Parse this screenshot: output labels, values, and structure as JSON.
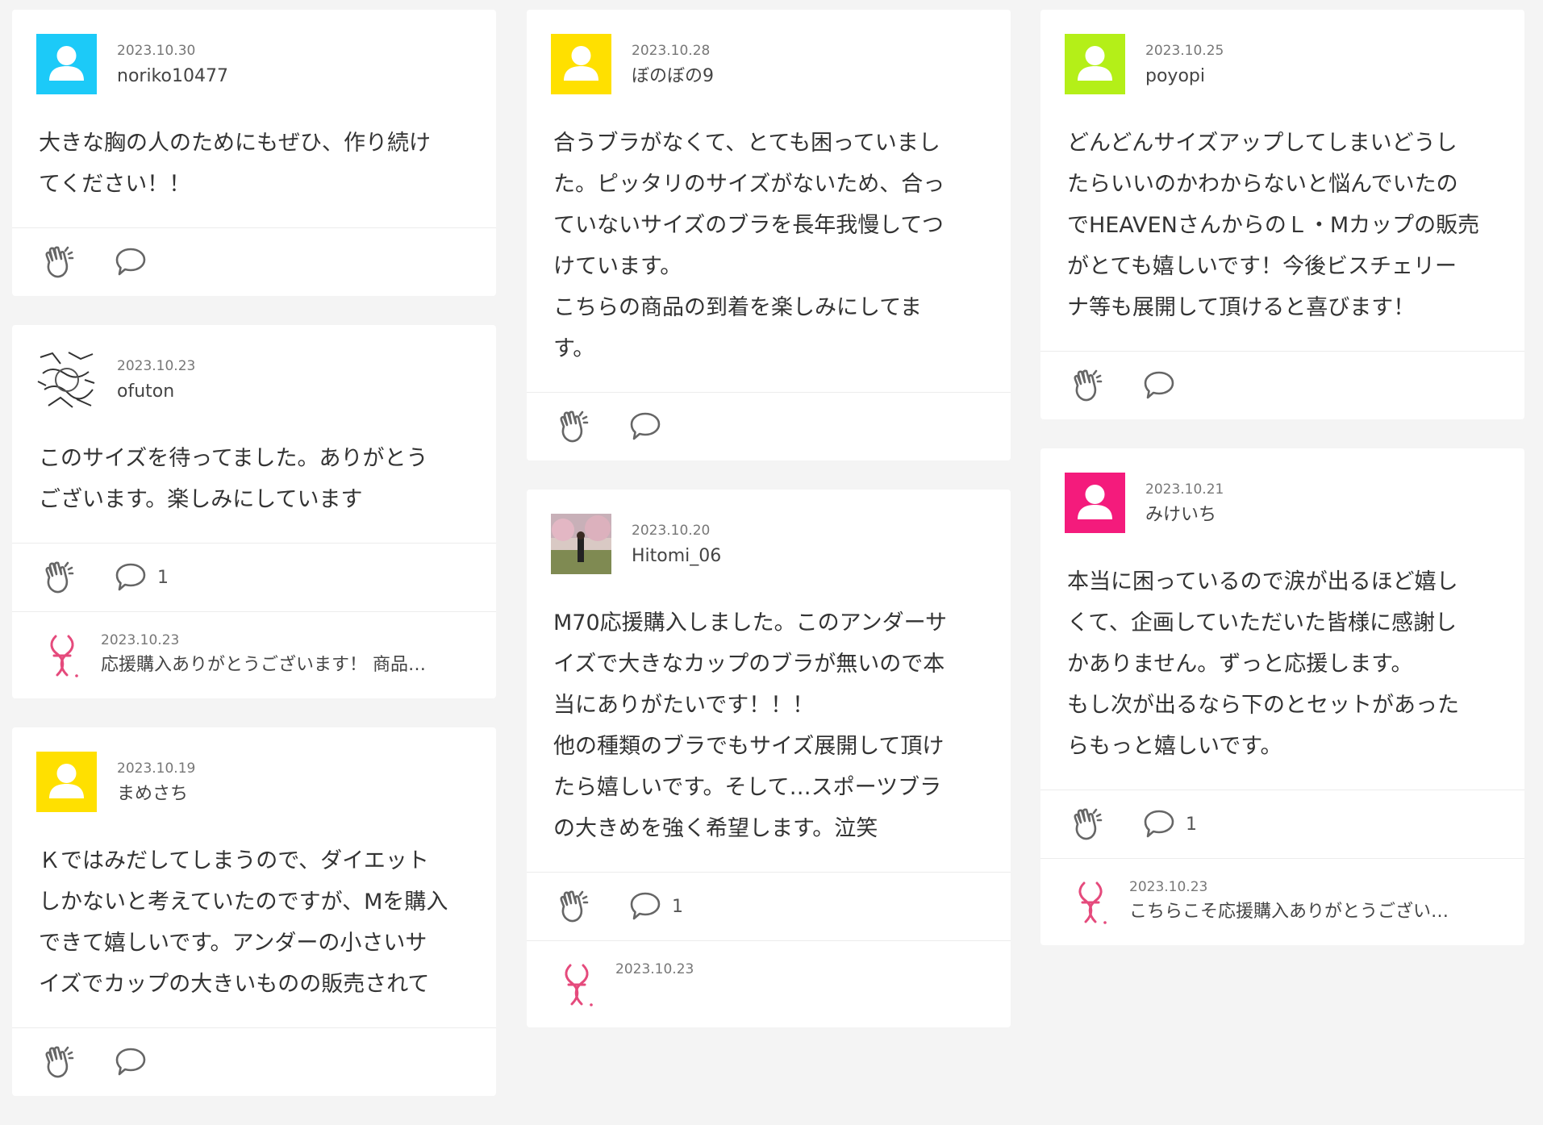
{
  "colors": {
    "avatar_cyan": "#1ccaf8",
    "avatar_yellow": "#ffe000",
    "avatar_lime": "#b4ef18",
    "avatar_pink": "#f41b7c",
    "brand_pink": "#e54a7c"
  },
  "columns": [
    {
      "cards": [
        {
          "date": "2023.10.30",
          "user": "noriko10477",
          "avatar": "avatar-cyan",
          "text": "大きな胸の人のためにもぜひ、作り続け\nてください！！",
          "comment_count": ""
        },
        {
          "date": "2023.10.23",
          "user": "ofuton",
          "avatar": "avatar-sketch",
          "text": "このサイズを待ってました。ありがとう\nございます。楽しみにしています",
          "comment_count": "1",
          "reply": {
            "date": "2023.10.23",
            "text": "応援購入ありがとうございます！ 商品…"
          }
        },
        {
          "date": "2023.10.19",
          "user": "まめさち",
          "avatar": "avatar-yellow",
          "text": "Ｋではみだしてしまうので、ダイエット\nしかないと考えていたのですが、Mを購入\nできて嬉しいです。アンダーの小さいサ\nイズでカップの大きいものの販売されて",
          "comment_count": ""
        }
      ]
    },
    {
      "cards": [
        {
          "date": "2023.10.28",
          "user": "ぼのぼの9",
          "avatar": "avatar-yellow",
          "text": "合うブラがなくて、とても困っていまし\nた。ピッタリのサイズがないため、合っ\nていないサイズのブラを長年我慢してつ\nけています。\nこちらの商品の到着を楽しみにしてま\nす。",
          "comment_count": ""
        },
        {
          "date": "2023.10.20",
          "user": "Hitomi_06",
          "avatar": "avatar-photo",
          "text": "M70応援購入しました。このアンダーサ\nイズで大きなカップのブラが無いので本\n当にありがたいです！！！\n他の種類のブラでもサイズ展開して頂け\nたら嬉しいです。そして…スポーツブラ\nの大きめを強く希望します。泣笑",
          "comment_count": "1",
          "reply": {
            "date": "2023.10.23",
            "text": ""
          }
        }
      ]
    },
    {
      "cards": [
        {
          "date": "2023.10.25",
          "user": "poyopi",
          "avatar": "avatar-lime",
          "text": "どんどんサイズアップしてしまいどうし\nたらいいのかわからないと悩んでいたの\nでHEAVENさんからのＬ・Mカップの販売\nがとても嬉しいです！今後ビスチェリー\nナ等も展開して頂けると喜びます！",
          "comment_count": ""
        },
        {
          "date": "2023.10.21",
          "user": "みけいち",
          "avatar": "avatar-pink",
          "text": "本当に困っているので涙が出るほど嬉し\nくて、企画していただいた皆様に感謝し\nかありません。ずっと応援します。\nもし次が出るなら下のとセットがあった\nらもっと嬉しいです。",
          "comment_count": "1",
          "reply": {
            "date": "2023.10.23",
            "text": "こちらこそ応援購入ありがとうござい…"
          }
        }
      ]
    }
  ]
}
